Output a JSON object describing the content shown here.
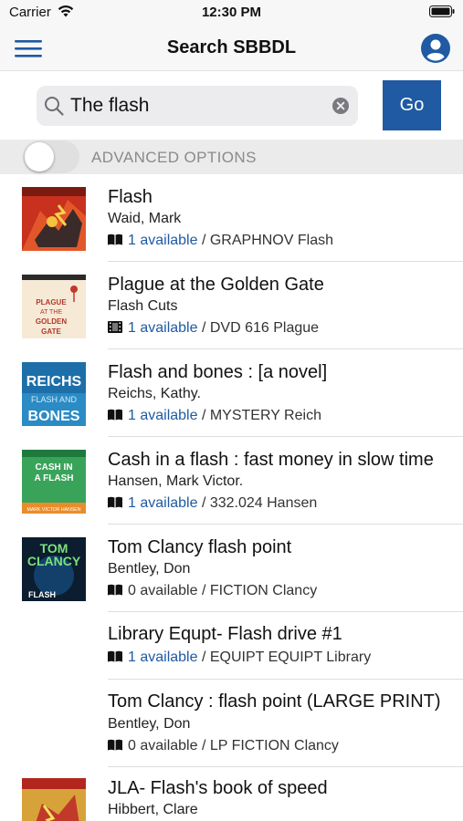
{
  "status_bar": {
    "carrier": "Carrier",
    "time": "12:30 PM",
    "icons": [
      "wifi-icon",
      "battery-icon"
    ]
  },
  "nav": {
    "title": "Search SBBDL",
    "menu_icon": "hamburger-menu-icon",
    "account_icon": "account-icon"
  },
  "search": {
    "value": "The flash",
    "go_label": "Go",
    "icons": [
      "search-icon",
      "clear-icon"
    ]
  },
  "advanced": {
    "label": "ADVANCED OPTIONS",
    "enabled": false
  },
  "colors": {
    "accent": "#1f5aa3",
    "bar_background": "#f7f7f7",
    "advanced_background": "#ebebeb"
  },
  "results": [
    {
      "title": "Flash",
      "author": "Waid, Mark",
      "format_icon": "book-icon",
      "availability": "1 available",
      "call_number": "GRAPHNOV Flash",
      "has_cover": true
    },
    {
      "title": "Plague at the Golden Gate",
      "author": "Flash Cuts",
      "format_icon": "dvd-icon",
      "availability": "1 available",
      "call_number": "DVD 616 Plague",
      "has_cover": true
    },
    {
      "title": "Flash and bones : [a novel]",
      "author": "Reichs, Kathy.",
      "format_icon": "book-icon",
      "availability": "1 available",
      "call_number": "MYSTERY Reich",
      "has_cover": true
    },
    {
      "title": "Cash in a flash : fast money in slow time",
      "author": "Hansen, Mark Victor.",
      "format_icon": "book-icon",
      "availability": "1 available",
      "call_number": "332.024 Hansen",
      "has_cover": true
    },
    {
      "title": "Tom Clancy flash point",
      "author": "Bentley, Don",
      "format_icon": "book-icon",
      "availability": "0 available",
      "call_number": "FICTION Clancy",
      "has_cover": true
    },
    {
      "title": "Library Equpt- Flash drive #1",
      "author": "",
      "format_icon": "book-icon",
      "availability": "1 available",
      "call_number": "EQUIPT EQUIPT Library",
      "has_cover": false
    },
    {
      "title": "Tom Clancy : flash point (LARGE PRINT)",
      "author": "Bentley, Don",
      "format_icon": "book-icon",
      "availability": "0 available",
      "call_number": "LP FICTION Clancy",
      "has_cover": false
    },
    {
      "title": "JLA- Flash's book of speed",
      "author": "Hibbert, Clare",
      "format_icon": "book-icon",
      "availability": "",
      "call_number": "",
      "has_cover": true
    }
  ],
  "cover_text": {
    "r2": [
      "PLAGUE",
      "AT THE",
      "GOLDEN",
      "GATE"
    ],
    "r3": [
      "REICHS",
      "FLASH AND",
      "BONES"
    ],
    "r4": [
      "CASH IN",
      "A FLASH",
      "MARK VICTOR HANSEN"
    ],
    "r5": [
      "TOM",
      "CLANCY",
      "FLASH"
    ]
  }
}
